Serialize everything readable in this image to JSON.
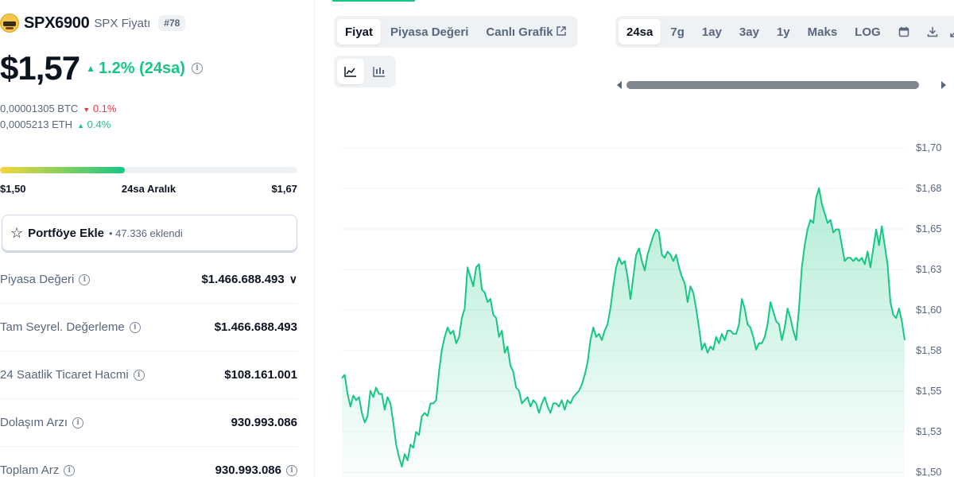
{
  "coin": {
    "name": "SPX6900",
    "subtitle": "SPX Fiyatı",
    "rank": "#78",
    "logo_icon": "spx6900-logo"
  },
  "price": {
    "value": "$1,57",
    "change": "1.2% (24sa)",
    "change_direction": "up"
  },
  "conversions": [
    {
      "value": "0,00001305 BTC",
      "change": "0.1%",
      "direction": "down"
    },
    {
      "value": "0,0005213 ETH",
      "change": "0.4%",
      "direction": "up"
    }
  ],
  "range": {
    "low": "$1,50",
    "label": "24sa Aralık",
    "high": "$1,67",
    "fill_fraction": 0.42
  },
  "portfolio": {
    "label": "Portföye Ekle",
    "count": "• 47.336 eklendi"
  },
  "stats": [
    {
      "label": "Piyasa Değeri",
      "value": "$1.466.688.493",
      "expandable": true
    },
    {
      "label": "Tam Seyrel. Değerleme",
      "value": "$1.466.688.493"
    },
    {
      "label": "24 Saatlik Ticaret Hacmi",
      "value": "$108.161.001"
    },
    {
      "label": "Dolaşım Arzı",
      "value": "930.993.086"
    },
    {
      "label": "Toplam Arz",
      "value": "930.993.086"
    }
  ],
  "chart_tabs": [
    {
      "label": "Fiyat",
      "active": true
    },
    {
      "label": "Piyasa Değeri",
      "active": false
    },
    {
      "label": "Canlı Grafik",
      "active": false,
      "external": true
    }
  ],
  "chart_views": [
    {
      "icon": "line-chart-icon",
      "active": true
    },
    {
      "icon": "candlestick-icon",
      "active": false
    }
  ],
  "ranges": [
    {
      "label": "24sa",
      "active": true
    },
    {
      "label": "7g"
    },
    {
      "label": "1ay"
    },
    {
      "label": "3ay"
    },
    {
      "label": "1y"
    },
    {
      "label": "Maks"
    },
    {
      "label": "LOG"
    }
  ],
  "colors": {
    "up": "#16c784",
    "down": "#ea3943",
    "line": "#16c784"
  },
  "chart_data": {
    "type": "area",
    "y_ticks": [
      "$1,70",
      "$1,68",
      "$1,65",
      "$1,63",
      "$1,60",
      "$1,58",
      "$1,55",
      "$1,53",
      "$1,50"
    ],
    "ylim": [
      1.496,
      1.702
    ],
    "grid": true,
    "values": [
      1.556,
      1.558,
      1.546,
      1.538,
      1.545,
      1.542,
      1.544,
      1.534,
      1.528,
      1.532,
      1.548,
      1.544,
      1.55,
      1.546,
      1.546,
      1.536,
      1.544,
      1.54,
      1.528,
      1.514,
      1.506,
      1.5,
      1.508,
      1.504,
      1.514,
      1.512,
      1.522,
      1.52,
      1.532,
      1.534,
      1.532,
      1.54,
      1.54,
      1.542,
      1.56,
      1.574,
      1.582,
      1.588,
      1.584,
      1.586,
      1.578,
      1.582,
      1.594,
      1.6,
      1.626,
      1.62,
      1.614,
      1.626,
      1.628,
      1.612,
      1.61,
      1.604,
      1.606,
      1.596,
      1.594,
      1.582,
      1.586,
      1.572,
      1.576,
      1.564,
      1.56,
      1.55,
      1.548,
      1.54,
      1.542,
      1.544,
      1.538,
      1.542,
      1.54,
      1.534,
      1.54,
      1.544,
      1.538,
      1.534,
      1.54,
      1.54,
      1.538,
      1.542,
      1.536,
      1.542,
      1.54,
      1.544,
      1.546,
      1.548,
      1.552,
      1.558,
      1.566,
      1.58,
      1.588,
      1.582,
      1.584,
      1.58,
      1.586,
      1.59,
      1.6,
      1.614,
      1.626,
      1.632,
      1.628,
      1.63,
      1.62,
      1.606,
      1.62,
      1.634,
      1.638,
      1.63,
      1.624,
      1.634,
      1.64,
      1.646,
      1.65,
      1.648,
      1.634,
      1.632,
      1.636,
      1.634,
      1.63,
      1.634,
      1.626,
      1.62,
      1.616,
      1.604,
      1.614,
      1.61,
      1.6,
      1.588,
      1.574,
      1.578,
      1.572,
      1.576,
      1.574,
      1.582,
      1.578,
      1.584,
      1.58,
      1.586,
      1.586,
      1.584,
      1.584,
      1.59,
      1.606,
      1.6,
      1.59,
      1.588,
      1.582,
      1.574,
      1.578,
      1.578,
      1.582,
      1.59,
      1.604,
      1.598,
      1.592,
      1.59,
      1.58,
      1.588,
      1.6,
      1.594,
      1.586,
      1.58,
      1.6,
      1.626,
      1.64,
      1.65,
      1.656,
      1.654,
      1.67,
      1.676,
      1.666,
      1.66,
      1.654,
      1.656,
      1.648,
      1.65,
      1.65,
      1.64,
      1.63,
      1.632,
      1.632,
      1.63,
      1.632,
      1.63,
      1.632,
      1.628,
      1.636,
      1.626,
      1.638,
      1.65,
      1.64,
      1.652,
      1.64,
      1.628,
      1.604,
      1.596,
      1.594,
      1.6,
      1.592,
      1.58
    ]
  }
}
